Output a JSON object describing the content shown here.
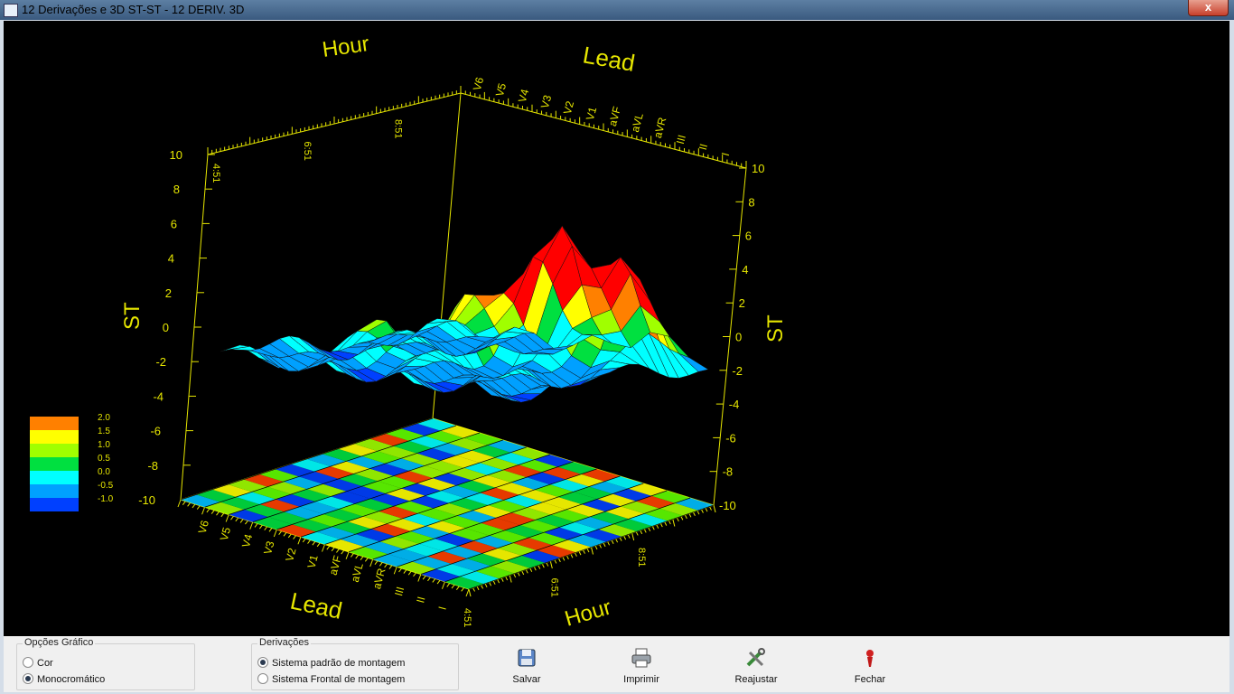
{
  "window": {
    "title": "12 Derivações e 3D ST-ST - 12 DERIV. 3D",
    "close_label": "x"
  },
  "chart": {
    "axis_hour": "Hour",
    "axis_lead": "Lead",
    "axis_st": "ST",
    "st_ticks": [
      "10",
      "8",
      "6",
      "4",
      "2",
      "0",
      "-2",
      "-4",
      "-6",
      "-8",
      "-10"
    ],
    "lead_ticks": [
      "V6",
      "V5",
      "V4",
      "V3",
      "V2",
      "V1",
      "aVF",
      "aVL",
      "aVR",
      "III",
      "II",
      "I"
    ],
    "hour_ticks": [
      "4:51",
      "6:51",
      "8:51"
    ]
  },
  "chart_data": {
    "type": "surface",
    "x_label": "Lead",
    "y_label": "Hour",
    "z_label": "ST",
    "leads": [
      "V6",
      "V5",
      "V4",
      "V3",
      "V2",
      "V1",
      "aVF",
      "aVL",
      "aVR",
      "III",
      "II",
      "I"
    ],
    "hours": [
      "4:51",
      "6:51",
      "8:51"
    ],
    "zlim": [
      -10,
      10
    ],
    "colorbar": {
      "labels": [
        "2.0",
        "1.5",
        "1.0",
        "0.5",
        "0.0",
        "-0.5",
        "-1.0"
      ],
      "colors": [
        "#ff8000",
        "#ffff00",
        "#a0ff00",
        "#00e040",
        "#00ffff",
        "#00a0ff",
        "#0040ff"
      ]
    }
  },
  "options": {
    "group_label": "Opções Gráfico",
    "items": [
      {
        "label": "Cor",
        "selected": false
      },
      {
        "label": "Monocromático",
        "selected": true
      }
    ]
  },
  "leads_group": {
    "group_label": "Derivações",
    "items": [
      {
        "label": "Sistema padrão de montagem",
        "selected": true
      },
      {
        "label": "Sistema Frontal de montagem",
        "selected": false
      }
    ]
  },
  "toolbar": {
    "save": "Salvar",
    "print": "Imprimir",
    "readjust": "Reajustar",
    "close": "Fechar"
  }
}
